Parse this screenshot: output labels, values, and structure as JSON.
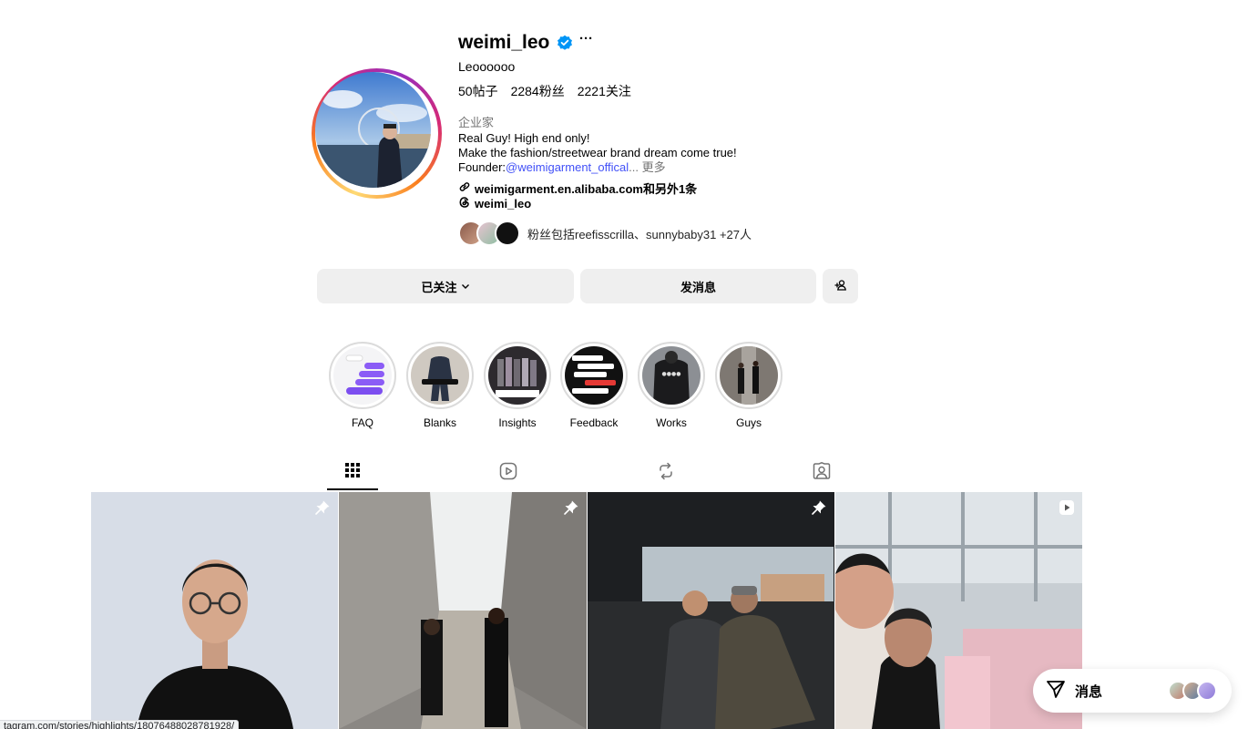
{
  "profile": {
    "username": "weimi_leo",
    "verified_icon": "verified-badge-icon",
    "more_icon": "more-options-icon",
    "full_name": "Leoooooo",
    "stats": {
      "posts": "50帖子",
      "followers": "2284粉丝",
      "following": "2221关注"
    },
    "category": "企业家",
    "bio_line1": "Real Guy! High end only!",
    "bio_line2": "Make the fashion/streetwear brand dream come true!",
    "bio_line3_prefix": "Founder:",
    "bio_line3_link": "@weimigarment_offical",
    "bio_line3_more": "... 更多",
    "external_link": "weimigarment.en.alibaba.com和另外1条",
    "threads_handle": "weimi_leo",
    "followed_by_text": "粉丝包括reefisscrilla、sunnybaby31 +27人"
  },
  "actions": {
    "following_label": "已关注",
    "message_label": "发消息"
  },
  "highlights": [
    {
      "label": "FAQ"
    },
    {
      "label": "Blanks"
    },
    {
      "label": "Insights"
    },
    {
      "label": "Feedback"
    },
    {
      "label": "Works"
    },
    {
      "label": "Guys"
    }
  ],
  "tabs": [
    "posts-grid-icon",
    "reels-icon",
    "reposts-icon",
    "tagged-icon"
  ],
  "messages_bubble": {
    "label": "消息"
  },
  "status_bar": {
    "url": "tagram.com/stories/highlights/18076488028781928/"
  },
  "colors": {
    "link": "#4150f7",
    "verified": "#0095f6",
    "button_bg": "#efefef"
  }
}
